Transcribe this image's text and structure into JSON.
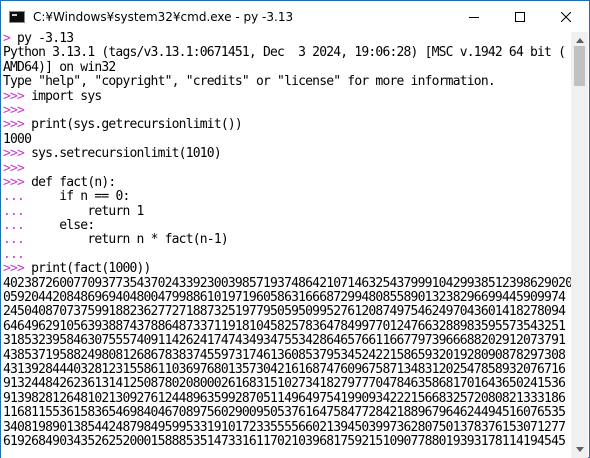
{
  "window": {
    "title": "C:¥Windows¥system32¥cmd.exe - py  -3.13",
    "icon": "cmd-icon",
    "controls": [
      "minimize-icon",
      "maximize-icon",
      "close-icon"
    ]
  },
  "console": {
    "prompt_color": "#c43cc7",
    "lines": [
      {
        "prompt": ">",
        "text": " py -3.13"
      },
      {
        "prompt": "",
        "text": "Python 3.13.1 (tags/v3.13.1:0671451, Dec  3 2024, 19:06:28) [MSC v.1942 64 bit ("
      },
      {
        "prompt": "",
        "text": "AMD64)] on win32"
      },
      {
        "prompt": "",
        "text": "Type \"help\", \"copyright\", \"credits\" or \"license\" for more information."
      },
      {
        "prompt": ">>>",
        "text": " import sys"
      },
      {
        "prompt": ">>>",
        "text": ""
      },
      {
        "prompt": ">>>",
        "text": " print(sys.getrecursionlimit())"
      },
      {
        "prompt": "",
        "text": "1000"
      },
      {
        "prompt": ">>>",
        "text": " sys.setrecursionlimit(1010)"
      },
      {
        "prompt": ">>>",
        "text": ""
      },
      {
        "prompt": ">>>",
        "text": " def fact(n):"
      },
      {
        "prompt": "...",
        "text": "     if n == 0:"
      },
      {
        "prompt": "...",
        "text": "         return 1"
      },
      {
        "prompt": "...",
        "text": "     else:"
      },
      {
        "prompt": "...",
        "text": "         return n * fact(n-1)"
      },
      {
        "prompt": "...",
        "text": ""
      },
      {
        "prompt": ">>>",
        "text": " print(fact(1000))"
      },
      {
        "prompt": "",
        "text": "402387260077093773543702433923003985719374864210714632543799910429938512398629020"
      },
      {
        "prompt": "",
        "text": "05920442084869694048004799886101971960586316668729948085589013238296699445909974"
      },
      {
        "prompt": "",
        "text": "24504087073759918823627727188732519779505950995276120874975462497043601418278094"
      },
      {
        "prompt": "",
        "text": "64649629105639388743788648733711918104582578364784997701247663288983595573543251"
      },
      {
        "prompt": "",
        "text": "31853239584630755574091142624174743493475534286465766116677973966688202912073791"
      },
      {
        "prompt": "",
        "text": "43853719588249808126867838374559731746136085379534524221586593201928090878297308"
      },
      {
        "prompt": "",
        "text": "43139284440328123155861103697680135730421616874760967587134831202547858932076716"
      },
      {
        "prompt": "",
        "text": "91324484262361314125087802080002616831510273418279777047846358681701643650241536"
      },
      {
        "prompt": "",
        "text": "91398281264810213092761244896359928705114964975419909342221566832572080821333186"
      },
      {
        "prompt": "",
        "text": "11681155361583654698404670897560290095053761647584772842188967964624494516076535"
      },
      {
        "prompt": "",
        "text": "34081989013854424879849599533191017233555566021394503997362807501378376153071277"
      },
      {
        "prompt": "",
        "text": "61926849034352625200015888535147331611702103968175921510907788019393178114194545"
      }
    ]
  }
}
